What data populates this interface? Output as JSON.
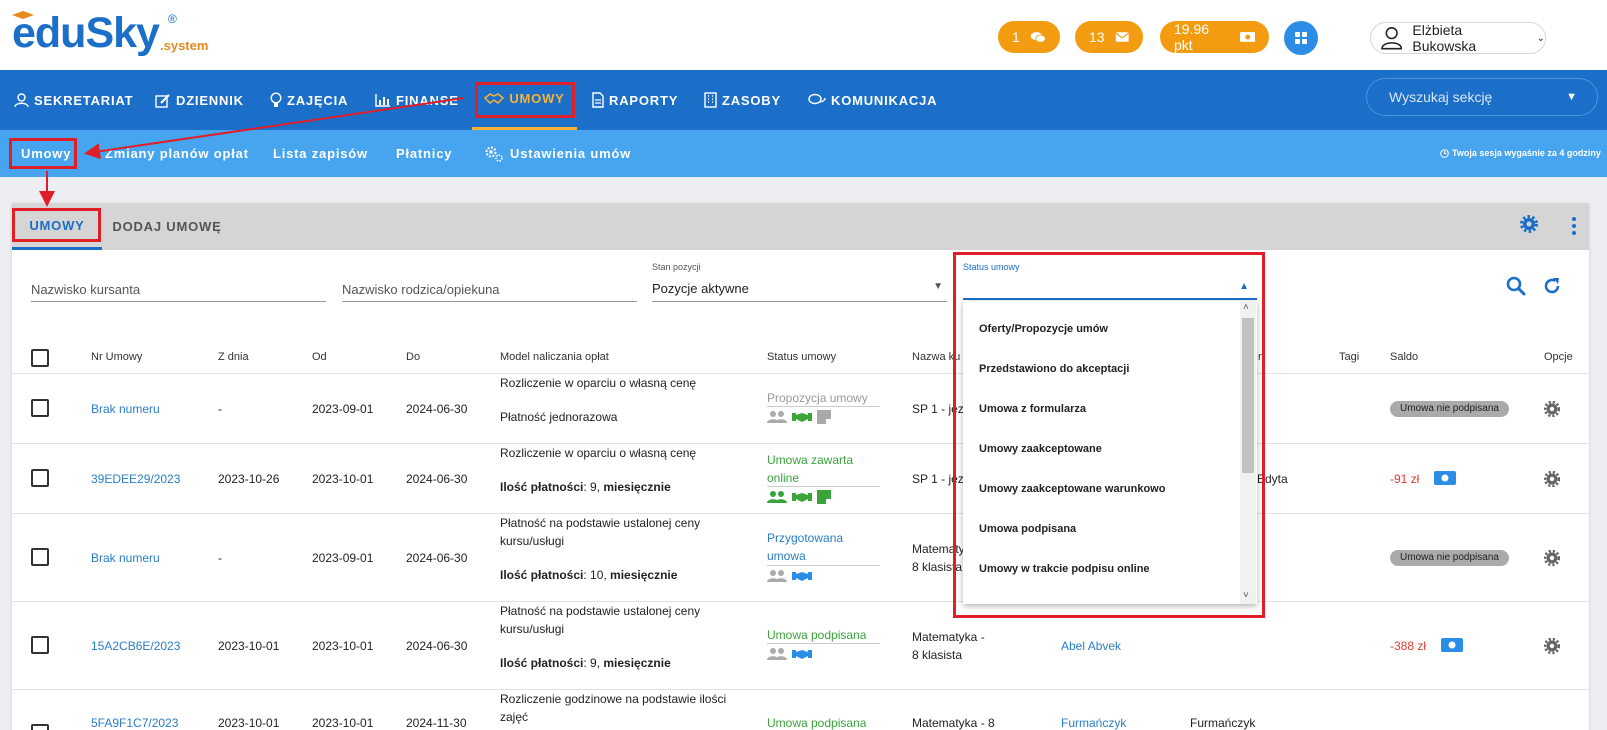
{
  "logo": {
    "main": "eduSky",
    "reg": "®",
    "sub": ".system"
  },
  "header": {
    "chat_count": "1",
    "mail_count": "13",
    "points": "19.96 pkt",
    "user_name": "Elżbieta Bukowska"
  },
  "nav": {
    "items": [
      "SEKRETARIAT",
      "DZIENNIK",
      "ZAJĘCIA",
      "FINANSE",
      "UMOWY",
      "RAPORTY",
      "ZASOBY",
      "KOMUNIKACJA"
    ],
    "search_placeholder": "Wyszukaj sekcję"
  },
  "subnav": {
    "items": [
      "Umowy",
      "Zmiany planów opłat",
      "Lista zapisów",
      "Płatnicy",
      "Ustawienia umów"
    ],
    "session": "Twoja sesja wygaśnie za 4 godziny"
  },
  "tabs": [
    "UMOWY",
    "DODAJ UMOWĘ"
  ],
  "filters": {
    "student_placeholder": "Nazwisko kursanta",
    "parent_placeholder": "Nazwisko rodzica/opiekuna",
    "position_label": "Stan pozycji",
    "position_value": "Pozycje aktywne",
    "status_label": "Status umowy"
  },
  "table": {
    "headers": [
      "Nr Umowy",
      "Z dnia",
      "Od",
      "Do",
      "Model naliczania opłat",
      "Status umowy",
      "Nazwa ku",
      "n",
      "Tagi",
      "Saldo",
      "Opcje"
    ],
    "rows": [
      {
        "nr": "Brak numeru",
        "zdnia": "-",
        "od": "2023-09-01",
        "do": "2024-06-30",
        "model1": "Rozliczenie w oparciu o własną cenę",
        "model2": "Płatność jednorazowa",
        "status": "Propozycja umowy",
        "nazwa": "SP 1 - języ",
        "saldo_badge": "Umowa nie podpisana"
      },
      {
        "nr": "39EDEE29/2023",
        "zdnia": "2023-10-26",
        "od": "2023-10-01",
        "do": "2024-06-30",
        "model1": "Rozliczenie w oparciu o własną cenę",
        "model2_label": "Ilość płatności",
        "model2_value": ": 9, ",
        "model2_freq": "miesięcznie",
        "status": "Umowa zawarta online",
        "nazwa": "SP 1 - języ",
        "extra": "Edyta",
        "saldo": "-91 zł"
      },
      {
        "nr": "Brak numeru",
        "zdnia": "-",
        "od": "2023-09-01",
        "do": "2024-06-30",
        "model1": "Płatność na podstawie ustalonej ceny kursu/usługi",
        "model2_label": "Ilość płatności",
        "model2_value": ": 10, ",
        "model2_freq": "miesięcznie",
        "status": "Przygotowana umowa",
        "nazwa": "Matematyka - 8 klasista",
        "saldo_badge": "Umowa nie podpisana"
      },
      {
        "nr": "15A2CB6E/2023",
        "zdnia": "2023-10-01",
        "od": "2023-10-01",
        "do": "2024-06-30",
        "model1": "Płatność na podstawie ustalonej ceny kursu/usługi",
        "model2_label": "Ilość płatności",
        "model2_value": ": 9, ",
        "model2_freq": "miesięcznie",
        "status": "Umowa podpisana",
        "nazwa": "Matematyka - 8 klasista",
        "person": "Abel Abvek",
        "saldo": "-388 zł"
      },
      {
        "nr": "5FA9F1C7/2023",
        "zdnia": "2023-10-01",
        "od": "2023-10-01",
        "do": "2024-11-30",
        "model1": "Rozliczenie godzinowe na podstawie ilości zajęć",
        "status": "Umowa podpisana",
        "nazwa": "Matematyka - 8",
        "person": "Furmańczyk",
        "extra": "Furmańczyk"
      }
    ]
  },
  "dropdown": {
    "options": [
      "Oferty/Propozycje umów",
      "Przedstawiono do akceptacji",
      "Umowa z formularza",
      "Umowy zaakceptowane",
      "Umowy zaakceptowane warunkowo",
      "Umowa podpisana",
      "Umowy w trakcie podpisu online"
    ]
  },
  "colors": {
    "primary": "#1b6fc8",
    "subnav": "#47a4ef",
    "accent": "#f39c12",
    "highlight": "#e01e27"
  }
}
